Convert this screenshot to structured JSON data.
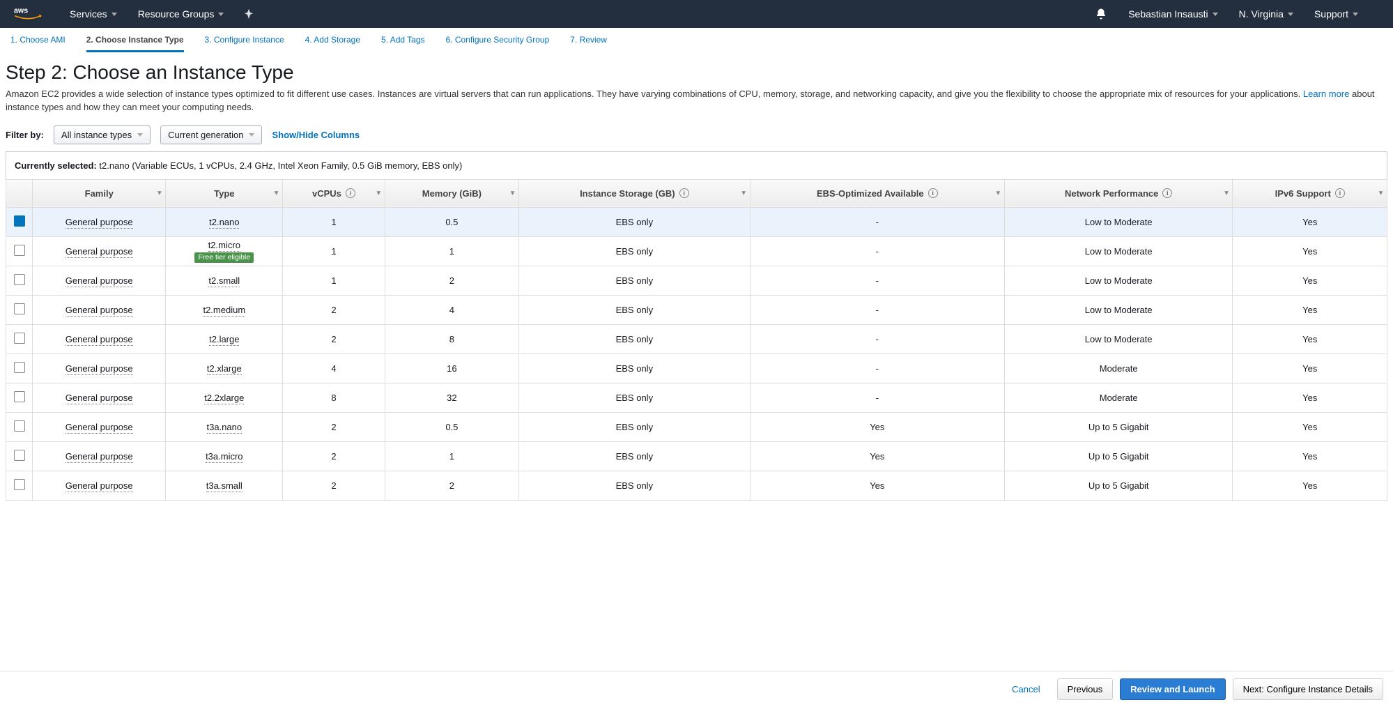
{
  "nav": {
    "services": "Services",
    "resource_groups": "Resource Groups",
    "user": "Sebastian Insausti",
    "region": "N. Virginia",
    "support": "Support"
  },
  "steps": [
    "1. Choose AMI",
    "2. Choose Instance Type",
    "3. Configure Instance",
    "4. Add Storage",
    "5. Add Tags",
    "6. Configure Security Group",
    "7. Review"
  ],
  "heading": "Step 2: Choose an Instance Type",
  "description_a": "Amazon EC2 provides a wide selection of instance types optimized to fit different use cases. Instances are virtual servers that can run applications. They have varying combinations of CPU, memory, storage, and networking capacity, and give you the flexibility to choose the appropriate mix of resources for your applications.",
  "learn_more": "Learn more",
  "description_b": "about instance types and how they can meet your computing needs.",
  "filter": {
    "label": "Filter by:",
    "all_types": "All instance types",
    "generation": "Current generation",
    "columns": "Show/Hide Columns"
  },
  "currently_selected_label": "Currently selected:",
  "currently_selected_value": "t2.nano (Variable ECUs, 1 vCPUs, 2.4 GHz, Intel Xeon Family, 0.5 GiB memory, EBS only)",
  "columns": {
    "family": "Family",
    "type": "Type",
    "vcpus": "vCPUs",
    "memory": "Memory (GiB)",
    "storage": "Instance Storage (GB)",
    "ebs": "EBS-Optimized Available",
    "network": "Network Performance",
    "ipv6": "IPv6 Support"
  },
  "free_tier_label": "Free tier eligible",
  "rows": [
    {
      "selected": true,
      "family": "General purpose",
      "type": "t2.nano",
      "free": false,
      "vcpus": "1",
      "memory": "0.5",
      "storage": "EBS only",
      "ebs": "-",
      "network": "Low to Moderate",
      "ipv6": "Yes"
    },
    {
      "selected": false,
      "family": "General purpose",
      "type": "t2.micro",
      "free": true,
      "vcpus": "1",
      "memory": "1",
      "storage": "EBS only",
      "ebs": "-",
      "network": "Low to Moderate",
      "ipv6": "Yes"
    },
    {
      "selected": false,
      "family": "General purpose",
      "type": "t2.small",
      "free": false,
      "vcpus": "1",
      "memory": "2",
      "storage": "EBS only",
      "ebs": "-",
      "network": "Low to Moderate",
      "ipv6": "Yes"
    },
    {
      "selected": false,
      "family": "General purpose",
      "type": "t2.medium",
      "free": false,
      "vcpus": "2",
      "memory": "4",
      "storage": "EBS only",
      "ebs": "-",
      "network": "Low to Moderate",
      "ipv6": "Yes"
    },
    {
      "selected": false,
      "family": "General purpose",
      "type": "t2.large",
      "free": false,
      "vcpus": "2",
      "memory": "8",
      "storage": "EBS only",
      "ebs": "-",
      "network": "Low to Moderate",
      "ipv6": "Yes"
    },
    {
      "selected": false,
      "family": "General purpose",
      "type": "t2.xlarge",
      "free": false,
      "vcpus": "4",
      "memory": "16",
      "storage": "EBS only",
      "ebs": "-",
      "network": "Moderate",
      "ipv6": "Yes"
    },
    {
      "selected": false,
      "family": "General purpose",
      "type": "t2.2xlarge",
      "free": false,
      "vcpus": "8",
      "memory": "32",
      "storage": "EBS only",
      "ebs": "-",
      "network": "Moderate",
      "ipv6": "Yes"
    },
    {
      "selected": false,
      "family": "General purpose",
      "type": "t3a.nano",
      "free": false,
      "vcpus": "2",
      "memory": "0.5",
      "storage": "EBS only",
      "ebs": "Yes",
      "network": "Up to 5 Gigabit",
      "ipv6": "Yes"
    },
    {
      "selected": false,
      "family": "General purpose",
      "type": "t3a.micro",
      "free": false,
      "vcpus": "2",
      "memory": "1",
      "storage": "EBS only",
      "ebs": "Yes",
      "network": "Up to 5 Gigabit",
      "ipv6": "Yes"
    },
    {
      "selected": false,
      "family": "General purpose",
      "type": "t3a.small",
      "free": false,
      "vcpus": "2",
      "memory": "2",
      "storage": "EBS only",
      "ebs": "Yes",
      "network": "Up to 5 Gigabit",
      "ipv6": "Yes"
    }
  ],
  "footer": {
    "cancel": "Cancel",
    "previous": "Previous",
    "review": "Review and Launch",
    "next": "Next: Configure Instance Details"
  }
}
